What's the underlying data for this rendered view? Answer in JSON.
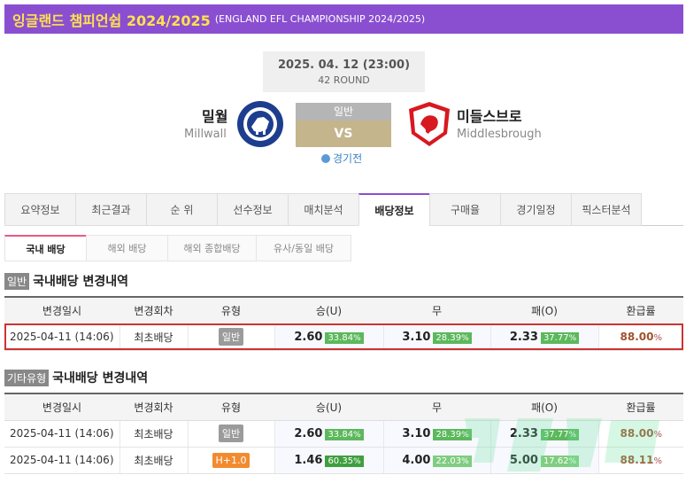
{
  "header": {
    "title": "잉글랜드 챔피언쉽 2024/2025",
    "subtitle": "(ENGLAND EFL CHAMPIONSHIP 2024/2025)"
  },
  "match": {
    "datetime": "2025. 04. 12 (23:00)",
    "round": "42 ROUND",
    "home_ko": "밀월",
    "home_en": "Millwall",
    "away_ko": "미들스브로",
    "away_en": "Middlesbrough",
    "type_label": "일반",
    "vs": "VS",
    "status": "경기전"
  },
  "tabs": [
    "요약정보",
    "최근결과",
    "순 위",
    "선수정보",
    "매치분석",
    "배당정보",
    "구매율",
    "경기일정",
    "픽스터분석"
  ],
  "subtabs": [
    "국내 배당",
    "해외 배당",
    "해외 종합배당",
    "유사/동일 배당"
  ],
  "section1": {
    "tag": "일반",
    "title": "국내배당 변경내역",
    "headers": [
      "변경일시",
      "변경회차",
      "유형",
      "승(U)",
      "무",
      "패(O)",
      "환급률"
    ],
    "rows": [
      {
        "date": "2025-04-11 (14:06)",
        "round": "최초배당",
        "type": "일반",
        "w": "2.60",
        "wp": "33.84",
        "d": "3.10",
        "dp": "28.39",
        "l": "2.33",
        "lp": "37.77",
        "refund": "88.00",
        "unit": "%"
      }
    ]
  },
  "section2": {
    "tag": "기타유형",
    "title": "국내배당 변경내역",
    "headers": [
      "변경일시",
      "변경회차",
      "유형",
      "승(U)",
      "무",
      "패(O)",
      "환급률"
    ],
    "rows": [
      {
        "date": "2025-04-11 (14:06)",
        "round": "최초배당",
        "type": "일반",
        "w": "2.60",
        "wp": "33.84",
        "d": "3.10",
        "dp": "28.39",
        "l": "2.33",
        "lp": "37.77",
        "refund": "88.00",
        "unit": "%"
      },
      {
        "date": "2025-04-11 (14:06)",
        "round": "최초배당",
        "type": "H+1.0",
        "w": "1.46",
        "wp": "60.35",
        "d": "4.00",
        "dp": "22.03",
        "l": "5.00",
        "lp": "17.62",
        "refund": "88.11",
        "unit": "%"
      }
    ]
  },
  "colors": {
    "purple": "#8a4fd0",
    "gold": "#ffe14d",
    "green": "#5cb85c",
    "orange": "#f28b30"
  }
}
